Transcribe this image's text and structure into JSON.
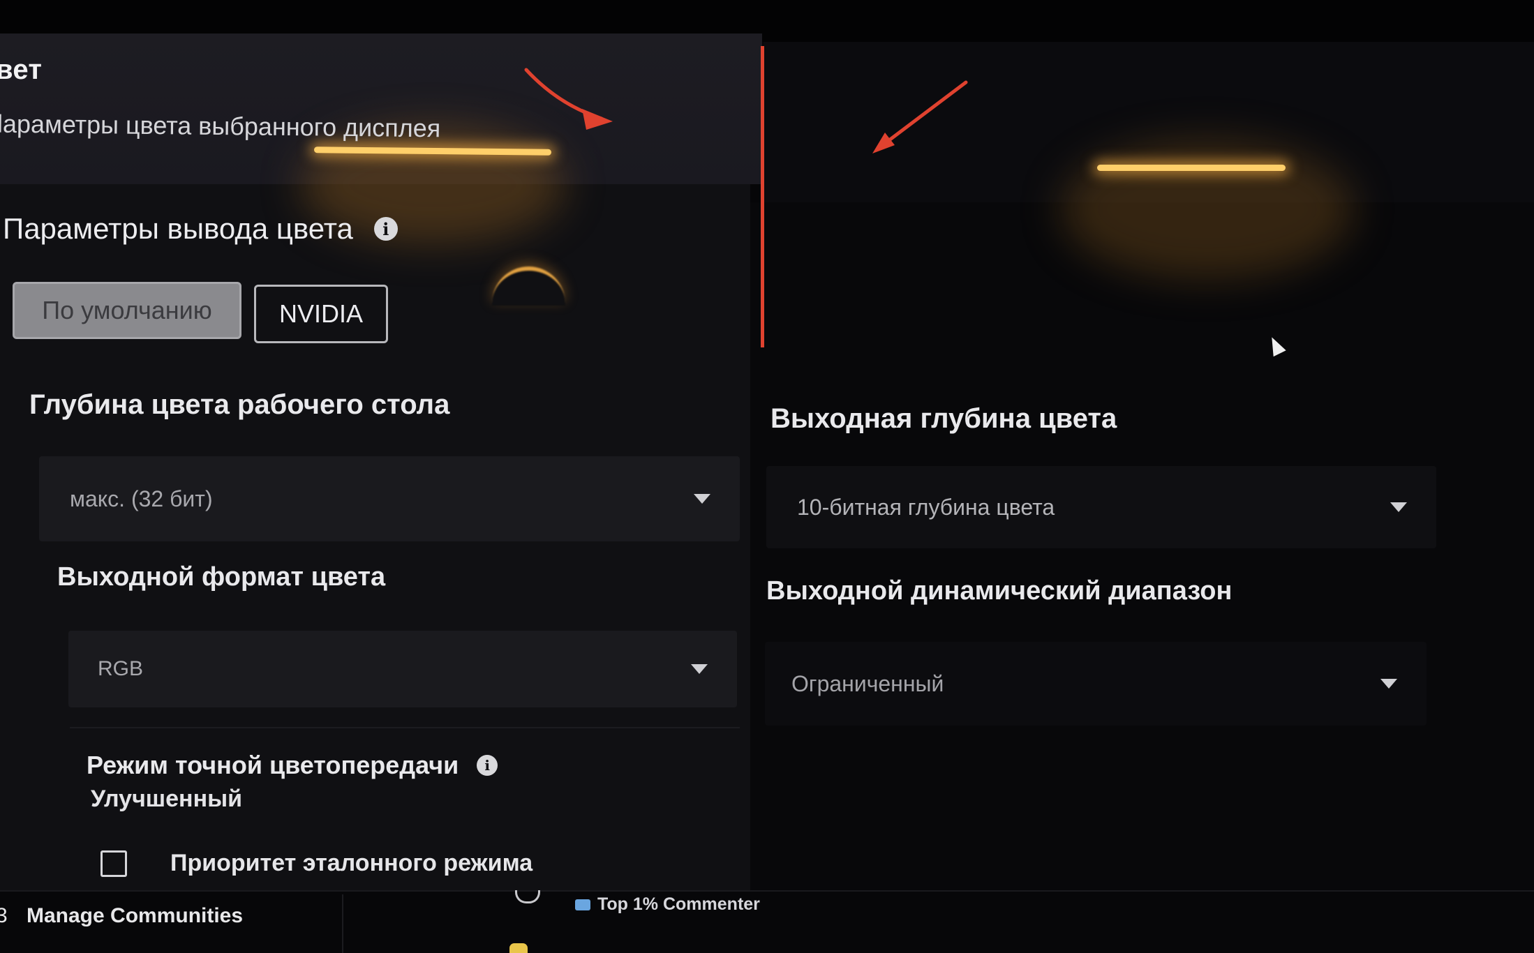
{
  "header": {
    "title": "вет",
    "subtitle": "lараметры цвета выбранного дисплея"
  },
  "color_output": {
    "section_title": "Параметры вывода цвета",
    "buttons": {
      "default_label": "По умолчанию",
      "nvidia_label": "NVIDIA"
    },
    "desktop_depth": {
      "label": "Глубина цвета рабочего стола",
      "value": "макс. (32 бит)"
    },
    "output_format": {
      "label": "Выходной формат цвета",
      "value": "RGB"
    },
    "output_depth": {
      "label": "Выходная глубина цвета",
      "value": "10-битная глубина цвета"
    },
    "dynamic_range": {
      "label": "Выходной динамический диапазон",
      "value": "Ограниченный"
    },
    "precision_mode": {
      "label": "Режим точной цветопередачи",
      "value": "Улучшенный"
    },
    "reference_priority": {
      "label": "Приоритет эталонного режима",
      "checked": false
    }
  },
  "footer": {
    "left_fragment": "3",
    "manage_communities": "Manage Communities",
    "badge": "Top 1% Commenter"
  },
  "annotations": {
    "arrow_color": "#e0422f"
  },
  "icons": {
    "info": "info-icon",
    "dropdown": "chevron-down-icon",
    "cursor": "mouse-cursor-icon",
    "badge": "badge-icon"
  }
}
